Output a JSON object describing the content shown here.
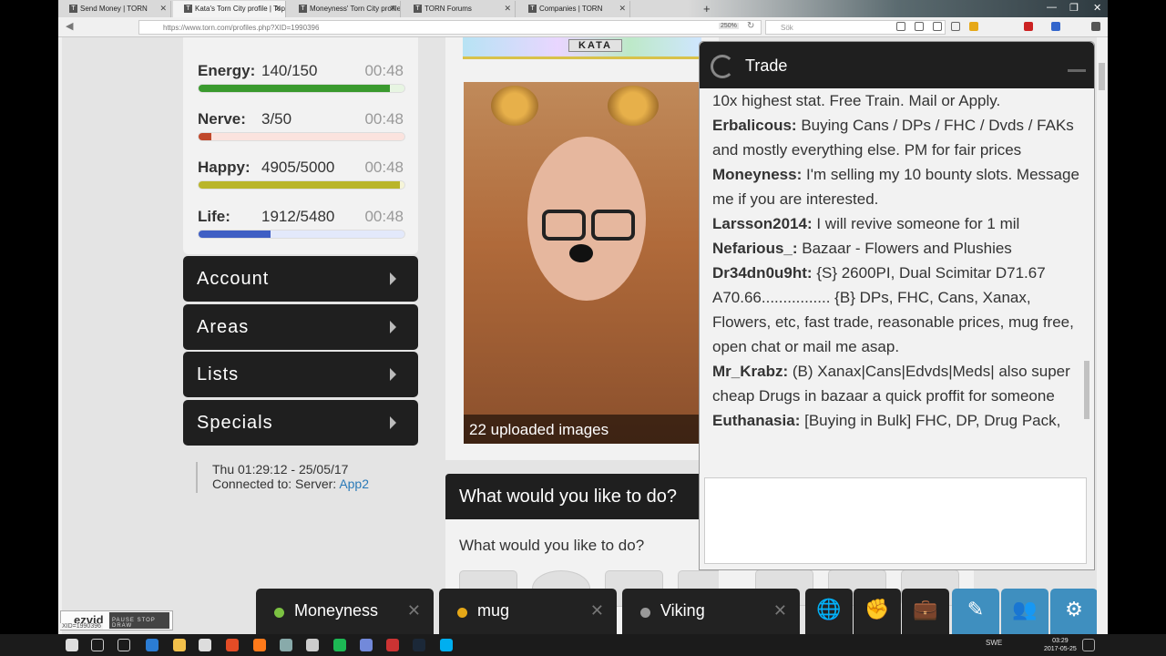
{
  "browser": {
    "tabs": [
      {
        "title": "Send Money | TORN"
      },
      {
        "title": "Kata's Torn City profile | Top"
      },
      {
        "title": "Moneyness' Torn City profile"
      },
      {
        "title": "TORN Forums"
      },
      {
        "title": "Companies | TORN"
      }
    ],
    "url": "https://www.torn.com/profiles.php?XID=1990396",
    "zoom": "250%",
    "search_placeholder": "Sök",
    "tab_icon_letter": "T"
  },
  "stats": [
    {
      "name": "Energy:",
      "value": "140/150",
      "time": "00:48",
      "fraction": 0.93,
      "color": "#3a9a2e",
      "track": "#e7f5e2"
    },
    {
      "name": "Nerve:",
      "value": "3/50",
      "time": "00:48",
      "fraction": 0.06,
      "color": "#c0482b",
      "track": "#fbe3de"
    },
    {
      "name": "Happy:",
      "value": "4905/5000",
      "time": "00:48",
      "fraction": 0.98,
      "color": "#b9b52a",
      "track": "#f6f5d8"
    },
    {
      "name": "Life:",
      "value": "1912/5480",
      "time": "00:48",
      "fraction": 0.35,
      "color": "#3f5fc4",
      "track": "#e3e9fb"
    }
  ],
  "menu": [
    {
      "label": "Account"
    },
    {
      "label": "Areas"
    },
    {
      "label": "Lists"
    },
    {
      "label": "Specials"
    }
  ],
  "server": {
    "datetime": "Thu 01:29:12 - 25/05/17",
    "connected_label": "Connected to: Server:",
    "server_name": "App2"
  },
  "profile": {
    "banner_name": "KATA",
    "uploaded_caption": "22 uploaded images"
  },
  "actions": {
    "header": "What would you like to do?",
    "prompt": "What would you like to do?"
  },
  "trade_chat": {
    "title": "Trade",
    "messages": [
      {
        "user": "",
        "text": "10x highest stat. Free Train. Mail or Apply."
      },
      {
        "user": "Erbalicous:",
        "text": "Buying Cans / DPs / FHC / Dvds / FAKs and mostly everything else. PM for fair prices"
      },
      {
        "user": "Moneyness:",
        "text": "I'm selling my 10 bounty slots. Message me if you are interested."
      },
      {
        "user": "Larsson2014:",
        "text": "I will revive someone for 1 mil"
      },
      {
        "user": "Nefarious_:",
        "text": "Bazaar - Flowers and Plushies"
      },
      {
        "user": "Dr34dn0u9ht:",
        "text": "{S} 2600PI, Dual Scimitar D71.67 A70.66................ {B} DPs, FHC, Cans, Xanax, Flowers, etc, fast trade, reasonable prices, mug free, open chat or mail me asap."
      },
      {
        "user": "Mr_Krabz:",
        "text": "(B) Xanax|Cans|Edvds|Meds| also super cheap Drugs in bazaar a quick proffit for someone"
      },
      {
        "user": "Euthanasia:",
        "text": "[Buying in Bulk] FHC, DP, Drug Pack,"
      }
    ]
  },
  "chat_tabs": [
    {
      "name": "Moneyness",
      "status_color": "#7cc242"
    },
    {
      "name": "mug",
      "status_color": "#e6a817"
    },
    {
      "name": "Viking",
      "status_color": "#999999"
    }
  ],
  "chat_icons": [
    {
      "icon": "globe-icon",
      "glyph": "🌐",
      "blue": false
    },
    {
      "icon": "fist-icon",
      "glyph": "✊",
      "blue": false
    },
    {
      "icon": "briefcase-icon",
      "glyph": "💼",
      "blue": false
    },
    {
      "icon": "pencil-icon",
      "glyph": "✎",
      "blue": true
    },
    {
      "icon": "people-icon",
      "glyph": "👥",
      "blue": true
    },
    {
      "icon": "gear-icon",
      "glyph": "⚙",
      "blue": true
    }
  ],
  "ezvid": {
    "logo": "ezvid",
    "buttons": "PAUSE STOP DRAW"
  },
  "status_bar_url": "XID=1990396",
  "taskbar": {
    "lang": "SWE",
    "time": "03:29",
    "date": "2017-05-25"
  }
}
